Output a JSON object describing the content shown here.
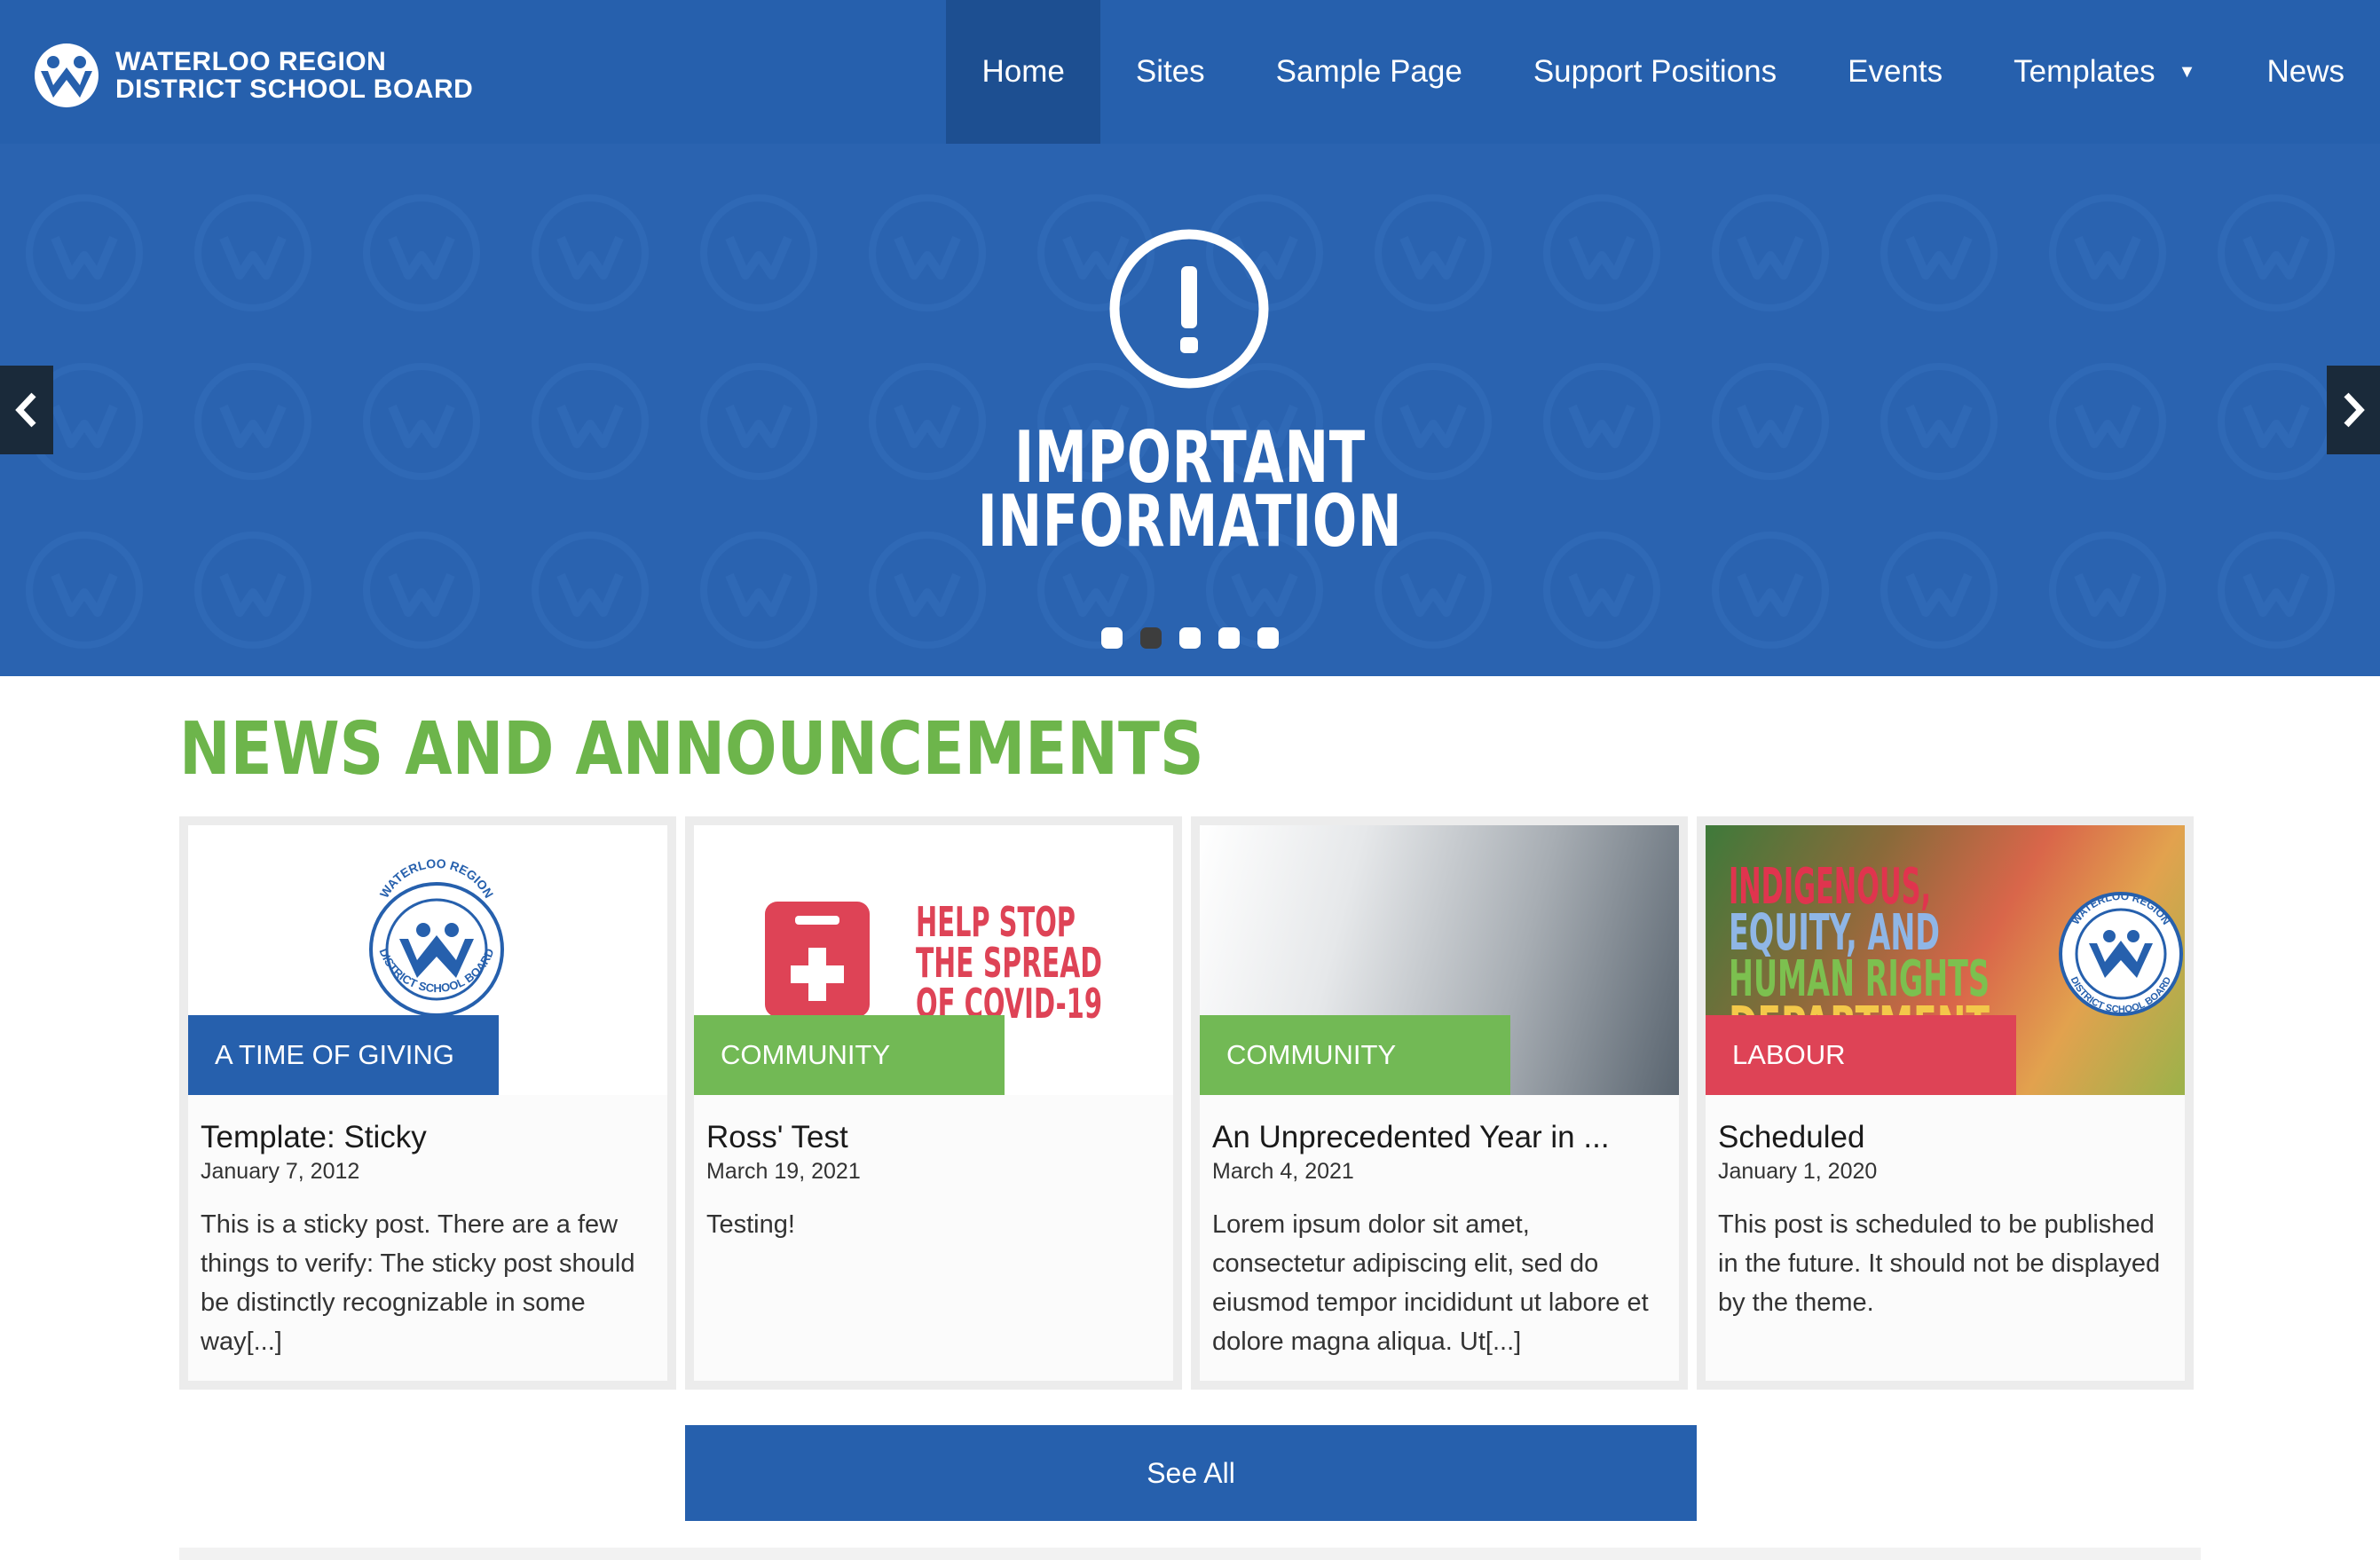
{
  "brand": {
    "name_line1": "WATERLOO REGION",
    "name_line2": "DISTRICT SCHOOL BOARD",
    "icon": "wrdsb-logo-icon",
    "seal_ring_top": "WATERLOO REGION",
    "seal_ring_bottom": "DISTRICT SCHOOL BOARD"
  },
  "nav": {
    "items": [
      {
        "label": "Home",
        "active": true
      },
      {
        "label": "Sites"
      },
      {
        "label": "Sample Page"
      },
      {
        "label": "Support Positions"
      },
      {
        "label": "Events"
      },
      {
        "label": "Templates",
        "has_dropdown": true
      },
      {
        "label": "News"
      }
    ],
    "dropdown_icon": "caret-down-icon"
  },
  "hero": {
    "icon": "exclamation-circle-icon",
    "title_line1": "IMPORTANT",
    "title_line2": "INFORMATION",
    "prev_icon": "chevron-left-icon",
    "next_icon": "chevron-right-icon",
    "slide_count": 5,
    "active_slide": 2
  },
  "news": {
    "heading": "NEWS AND ANNOUNCEMENTS",
    "cards": [
      {
        "category": "A TIME OF GIVING",
        "title": "Template: Sticky",
        "date": "January 7, 2012",
        "excerpt": "This is a sticky post. There are a few things to verify: The sticky post should be distinctly recognizable in some way[...]"
      },
      {
        "category": "COMMUNITY",
        "title": "Ross' Test",
        "date": "March 19, 2021",
        "excerpt": "Testing!",
        "image_text": [
          "HELP STOP",
          "THE SPREAD",
          "OF COVID-19"
        ]
      },
      {
        "category": "COMMUNITY",
        "title": "An Unprecedented Year in ...",
        "date": "March 4, 2021",
        "excerpt": "Lorem ipsum dolor sit amet, consectetur adipiscing elit, sed do eiusmod tempor incididunt ut labore et dolore magna aliqua. Ut[...]"
      },
      {
        "category": "LABOUR",
        "title": "Scheduled",
        "date": "January 1, 2020",
        "excerpt": "This post is scheduled to be published in the future. It should not be displayed by the theme.",
        "image_text": [
          "INDIGENOUS,",
          "EQUITY, AND",
          "HUMAN RIGHTS",
          "DEPARTMENT"
        ]
      }
    ],
    "see_all_label": "See All"
  },
  "colors": {
    "brand_blue": "#2660ad",
    "nav_active": "#1d4f91",
    "heading_green": "#6db54b",
    "cat_green": "#72b955",
    "cat_red": "#de4356"
  }
}
